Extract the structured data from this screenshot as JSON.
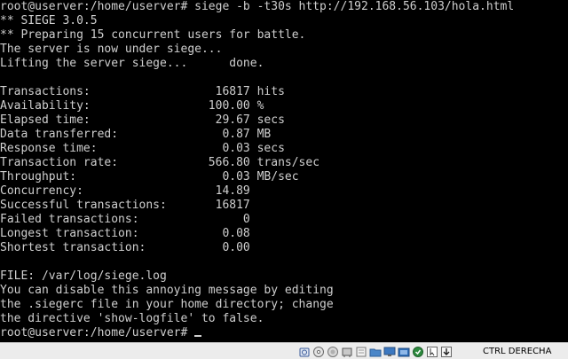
{
  "terminal": {
    "lines": [
      "root@userver:/home/userver# siege -b -t30s http://192.168.56.103/hola.html",
      "** SIEGE 3.0.5",
      "** Preparing 15 concurrent users for battle.",
      "The server is now under siege...",
      "Lifting the server siege...      done.",
      "",
      "Transactions:                  16817 hits",
      "Availability:                 100.00 %",
      "Elapsed time:                  29.67 secs",
      "Data transferred:               0.87 MB",
      "Response time:                  0.03 secs",
      "Transaction rate:             566.80 trans/sec",
      "Throughput:                     0.03 MB/sec",
      "Concurrency:                   14.89",
      "Successful transactions:       16817",
      "Failed transactions:               0",
      "Longest transaction:            0.08",
      "Shortest transaction:           0.00",
      "",
      "FILE: /var/log/siege.log",
      "You can disable this annoying message by editing",
      "the .siegerc file in your home directory; change",
      "the directive 'show-logfile' to false."
    ],
    "prompt": "root@userver:/home/userver# "
  },
  "statusbar": {
    "icons": [
      "hard-disk-icon",
      "optical-drive-icon",
      "audio-icon",
      "network-icon",
      "usb-icon",
      "shared-folders-icon",
      "display-icon",
      "video-capture-icon",
      "virtualization-icon",
      "mouse-integration-icon",
      "download-arrow-icon"
    ],
    "host_key_label": "CTRL DERECHA"
  }
}
